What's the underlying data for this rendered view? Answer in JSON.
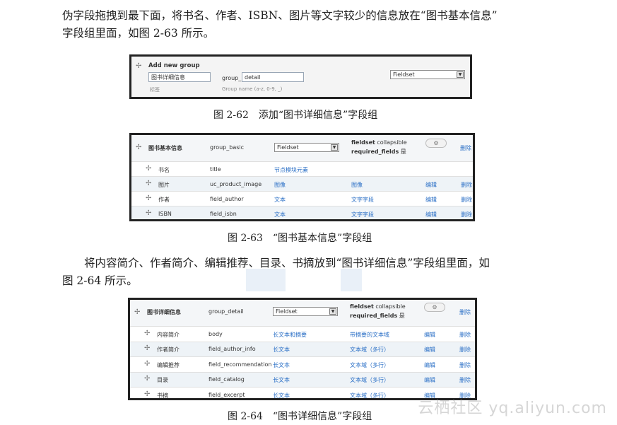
{
  "intro_paragraph": {
    "line1": "伪字段拖拽到最下面，将书名、作者、ISBN、图片等文字较少的信息放在“图书基本信息”",
    "line2": "字段组里面，如图 2-63 所示。"
  },
  "fig62": {
    "section_title": "Add new group",
    "label_value": "图书详细信息",
    "label_caption": "标签",
    "prefix": "group_",
    "name_value": "detail",
    "name_caption": "Group name (a-z, 0-9, _)",
    "widget_select": "Fieldset",
    "caption": "图 2-62　添加“图书详细信息”字段组"
  },
  "fig63": {
    "group_label": "图书基本信息",
    "group_name": "group_basic",
    "group_widget": "Fieldset",
    "settings_line1_key": "fieldset",
    "settings_line1_val": "collapsible",
    "settings_line2_key": "required_fields",
    "settings_line2_val": "是",
    "delete": "删除",
    "rows": [
      {
        "label": "书名",
        "name": "title",
        "type": "节点模块元素",
        "widget": "",
        "edit": "",
        "del": ""
      },
      {
        "label": "图片",
        "name": "uc_product_image",
        "type": "图像",
        "widget": "图像",
        "edit": "编辑",
        "del": "删除"
      },
      {
        "label": "作者",
        "name": "field_author",
        "type": "文本",
        "widget": "文字字段",
        "edit": "编辑",
        "del": "删除"
      },
      {
        "label": "ISBN",
        "name": "field_isbn",
        "type": "文本",
        "widget": "文字字段",
        "edit": "编辑",
        "del": "删除"
      }
    ],
    "caption": "图 2-63　“图书基本信息”字段组"
  },
  "middle_paragraph": {
    "line1": "将内容简介、作者简介、编辑推荐、目录、书摘放到“图书详细信息”字段组里面，如",
    "line2": "图 2-64 所示。"
  },
  "fig64": {
    "group_label": "图书详细信息",
    "group_name": "group_detail",
    "group_widget": "Fieldset",
    "settings_line1_key": "fieldset",
    "settings_line1_val": "collapsible",
    "settings_line2_key": "required_fields",
    "settings_line2_val": "是",
    "delete": "删除",
    "rows": [
      {
        "label": "内容简介",
        "name": "body",
        "type": "长文本和摘要",
        "widget": "带摘要的文本域",
        "edit": "编辑",
        "del": "删除"
      },
      {
        "label": "作者简介",
        "name": "field_author_info",
        "type": "长文本",
        "widget": "文本域（多行）",
        "edit": "编辑",
        "del": "删除"
      },
      {
        "label": "编辑推荐",
        "name": "field_recommendation",
        "type": "长文本",
        "widget": "文本域（多行）",
        "edit": "编辑",
        "del": "删除"
      },
      {
        "label": "目录",
        "name": "field_catalog",
        "type": "长文本",
        "widget": "文本域（多行）",
        "edit": "编辑",
        "del": "删除"
      },
      {
        "label": "书摘",
        "name": "field_excerpt",
        "type": "长文本",
        "widget": "文本域（多行）",
        "edit": "编辑",
        "del": "删除"
      }
    ],
    "caption": "图 2-64　“图书详细信息”字段组"
  },
  "watermark": "云栖社区 yq.aliyun.com",
  "icons": {
    "drag": "drag-handle-icon",
    "gear": "gear-icon",
    "dropdown": "chevron-down-icon"
  }
}
